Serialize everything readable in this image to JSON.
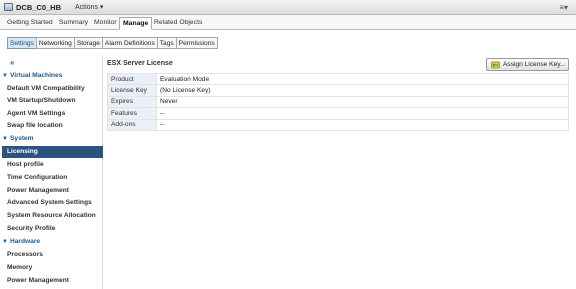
{
  "window": {
    "host_name": "DCB_C0_HB",
    "actions_label": "Actions ▾",
    "menu_icon": "≡▾"
  },
  "main_tabs": [
    {
      "label": "Getting Started"
    },
    {
      "label": "Summary"
    },
    {
      "label": "Monitor"
    },
    {
      "label": "Manage",
      "active": true
    },
    {
      "label": "Related Objects"
    }
  ],
  "sub_tabs": [
    {
      "label": "Settings",
      "active": true
    },
    {
      "label": "Networking"
    },
    {
      "label": "Storage"
    },
    {
      "label": "Alarm Definitions"
    },
    {
      "label": "Tags"
    },
    {
      "label": "Permissions"
    }
  ],
  "sidebar": {
    "collapse_icon": "«",
    "items": [
      {
        "label": "Virtual Machines",
        "type": "section"
      },
      {
        "label": "Default VM Compatibility"
      },
      {
        "label": "VM Startup/Shutdown"
      },
      {
        "label": "Agent VM Settings"
      },
      {
        "label": "Swap file location"
      },
      {
        "label": "System",
        "type": "section"
      },
      {
        "label": "Licensing",
        "selected": true
      },
      {
        "label": "Host profile"
      },
      {
        "label": "Time Configuration"
      },
      {
        "label": "Power Management"
      },
      {
        "label": "Advanced System Settings"
      },
      {
        "label": "System Resource Allocation"
      },
      {
        "label": "Security Profile"
      },
      {
        "label": "Hardware",
        "type": "section"
      },
      {
        "label": "Processors"
      },
      {
        "label": "Memory"
      },
      {
        "label": "Power Management"
      }
    ]
  },
  "content": {
    "title": "ESX Server License",
    "assign_button": "Assign License Key...",
    "properties": [
      {
        "key": "Product",
        "value": "Evaluation Mode"
      },
      {
        "key": "License Key",
        "value": "(No License Key)"
      },
      {
        "key": "Expires",
        "value": "Never"
      },
      {
        "key": "Features",
        "value": "--"
      },
      {
        "key": "Add-ons",
        "value": "--"
      }
    ]
  }
}
